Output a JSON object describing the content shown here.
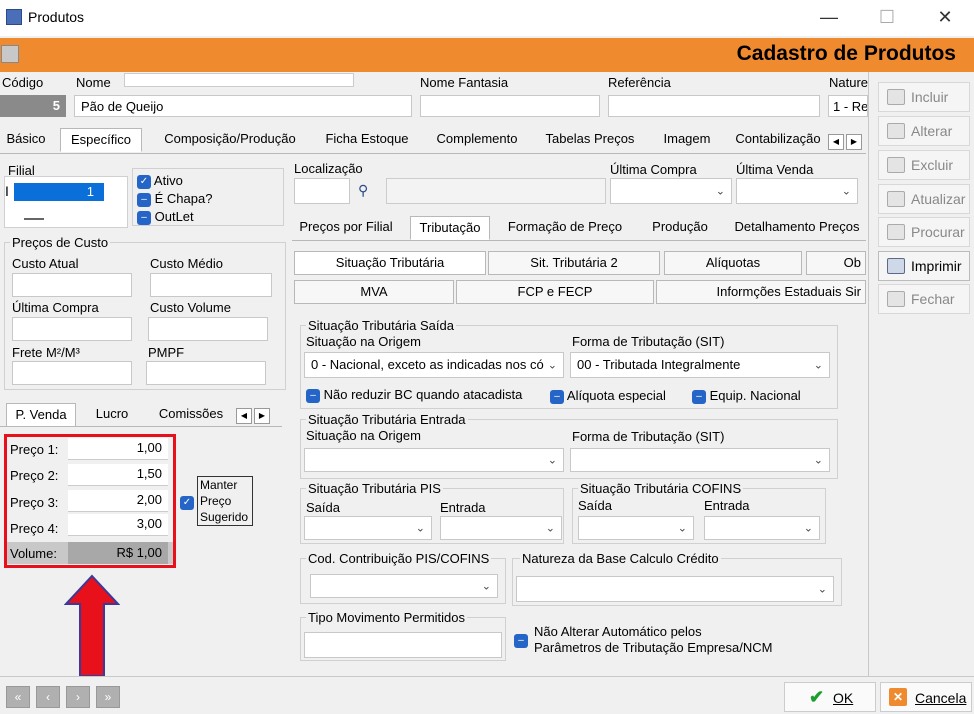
{
  "window": {
    "title": "Produtos",
    "minimize": "—",
    "maximize": "☐",
    "close": "✕"
  },
  "header": {
    "title": "Cadastro de Produtos"
  },
  "top_fields": {
    "codigo_label": "Código",
    "codigo_value": "5",
    "nome_label": "Nome",
    "nome_value": "Pão de Queijo",
    "fantasia_label": "Nome Fantasia",
    "referencia_label": "Referência",
    "natureza_label": "Nature",
    "natureza_value": "1 - Re"
  },
  "main_tabs": [
    "Básico",
    "Específico",
    "Composição/Produção",
    "Ficha Estoque",
    "Complemento",
    "Tabelas Preços",
    "Imagem",
    "Contabilização"
  ],
  "filial": {
    "label": "Filial",
    "value": "1"
  },
  "flags": {
    "ativo": "Ativo",
    "chapa": "É Chapa?",
    "outlet": "OutLet"
  },
  "precos_custo": {
    "title": "Preços de Custo",
    "custo_atual": "Custo Atual",
    "custo_medio": "Custo Médio",
    "ultima_compra": "Última Compra",
    "custo_volume": "Custo Volume",
    "frete": "Frete M²/M³",
    "pmpf": "PMPF"
  },
  "price_tabs": [
    "P. Venda",
    "Lucro",
    "Comissões"
  ],
  "prices": [
    {
      "label": "Preço 1:",
      "value": "1,00"
    },
    {
      "label": "Preço 2:",
      "value": "1,50"
    },
    {
      "label": "Preço 3:",
      "value": "2,00"
    },
    {
      "label": "Preço 4:",
      "value": "3,00"
    }
  ],
  "volume": {
    "label": "Volume:",
    "value": "R$ 1,00"
  },
  "manter": {
    "line1": "Manter",
    "line2": "Preço",
    "line3": "Sugerido"
  },
  "localizacao": {
    "label": "Localização",
    "ultima_compra": "Última Compra",
    "ultima_venda": "Última Venda"
  },
  "sub_tabs": [
    "Preços por Filial",
    "Tributação",
    "Formação de Preço",
    "Produção",
    "Detalhamento Preços"
  ],
  "trib_tabs_row1": [
    "Situação Tributária",
    "Sit. Tributária 2",
    "Alíquotas",
    "Ob"
  ],
  "trib_tabs_row2": [
    "MVA",
    "FCP e FECP",
    "Informções Estaduais Sir"
  ],
  "saida": {
    "title": "Situação Tributária Saída",
    "origem_label": "Situação na Origem",
    "origem_value": "0 - Nacional, exceto as indicadas nos có",
    "forma_label": "Forma de Tributação (SIT)",
    "forma_value": "00 - Tributada Integralmente",
    "nao_reduzir": "Não reduzir BC quando atacadista",
    "aliquota_especial": "Alíquota especial",
    "equip": "Equip. Nacional"
  },
  "entrada": {
    "title": "Situação Tributária Entrada",
    "origem_label": "Situação na Origem",
    "forma_label": "Forma de Tributação (SIT)"
  },
  "pis": {
    "title": "Situação Tributária PIS",
    "saida": "Saída",
    "entrada": "Entrada"
  },
  "cofins": {
    "title": "Situação Tributária COFINS",
    "saida": "Saída",
    "entrada": "Entrada"
  },
  "cod_contrib": "Cod. Contribuição PIS/COFINS",
  "natureza_base": "Natureza da Base Calculo Crédito",
  "tipo_mov": "Tipo Movimento Permitidos",
  "nao_alterar": {
    "line1": "Não Alterar Automático pelos",
    "line2": "Parâmetros de Tributação Empresa/NCM"
  },
  "side_buttons": [
    "Incluir",
    "Alterar",
    "Excluir",
    "Atualizar",
    "Procurar",
    "Imprimir",
    "Fechar"
  ],
  "footer": {
    "ok": "OK",
    "cancel": "Cancela"
  },
  "colors": {
    "orange": "#f08a2e",
    "highlight_red": "#e8101a",
    "checkbox_blue": "#2565c7"
  }
}
